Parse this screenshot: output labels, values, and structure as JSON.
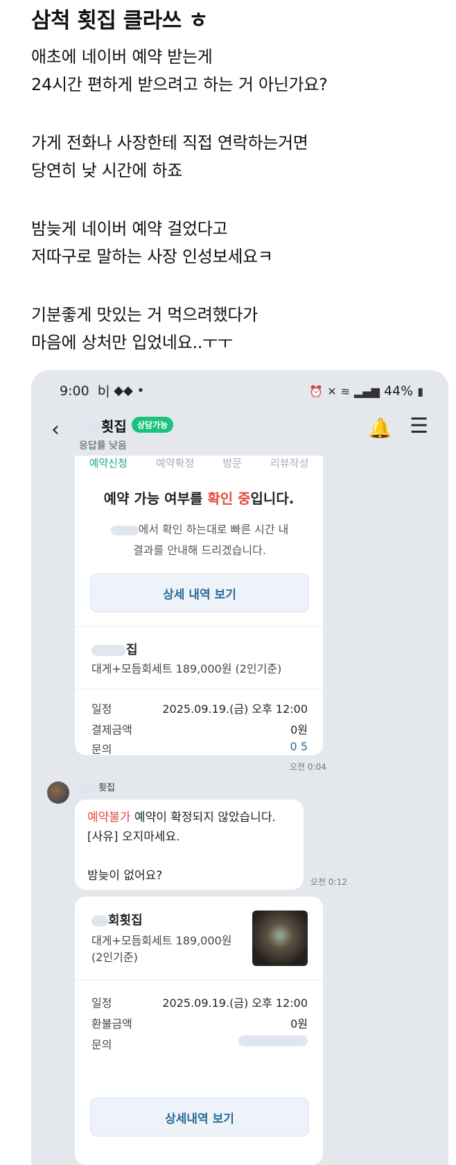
{
  "post": {
    "title": "삼척 횟집 클라쓰 ㅎ",
    "paragraphs": [
      [
        "애초에 네이버 예약 받는게",
        "24시간 편하게 받으려고 하는 거 아닌가요?"
      ],
      [
        "가게 전화나 사장한테 직접 연락하는거면",
        "당연히 낮 시간에 하죠"
      ],
      [
        "밤늦게 네이버 예약 걸었다고",
        "저따구로 말하는 사장 인성보세요ㅋ"
      ],
      [
        "기분좋게 맛있는 거 먹으려했다가",
        "마음에 상처만 입었네요..ㅜㅜ"
      ]
    ]
  },
  "phone": {
    "status": {
      "time": "9:00",
      "left_icons": "b| ◆◆ •",
      "battery": "44%"
    },
    "header": {
      "shop_name": "횟집",
      "badge": "상담가능",
      "response": "응답률 낮음"
    },
    "card1": {
      "steps": [
        "예약신청",
        "예약확정",
        "방문",
        "리뷰작성"
      ],
      "notice_title_pre": "예약 가능 여부를 ",
      "notice_title_red": "확인 중",
      "notice_title_post": "입니다.",
      "notice_desc_1": "에서 확인 하는대로 빠른 시간 내",
      "notice_desc_2": "결과를 안내해 드리겠습니다.",
      "detail_button": "상세 내역 보기",
      "shop": "집",
      "item": "대게+모듬회세트 189,000원 (2인기준)",
      "rows": [
        {
          "k": "일정",
          "v": "2025.09.19.(금) 오후 12:00"
        },
        {
          "k": "결제금액",
          "v": "0원"
        },
        {
          "k": "문의",
          "v": "0 5"
        }
      ],
      "time": "오전 0:04"
    },
    "message": {
      "sender": "횟집",
      "status_red": "예약불가",
      "line1_rest": " 예약이 확정되지 않았습니다.",
      "line2": "[사유] 오지마세요.",
      "line3": "밤늦이 없어요?",
      "time": "오전 0:12"
    },
    "card2": {
      "shop": "회횟집",
      "item_1": "대게+모듬회세트 189,000원",
      "item_2": "(2인기준)",
      "rows": [
        {
          "k": "일정",
          "v": "2025.09.19.(금) 오후 12:00"
        },
        {
          "k": "환불금액",
          "v": "0원"
        },
        {
          "k": "문의",
          "v": ""
        }
      ],
      "detail_button": "상세내역 보기"
    }
  }
}
